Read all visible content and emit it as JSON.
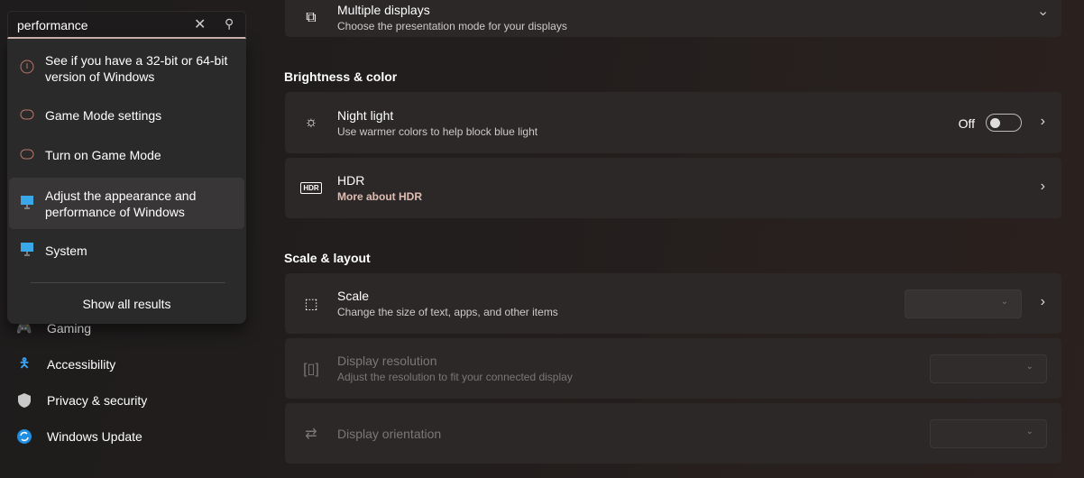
{
  "search": {
    "value": "performance",
    "clear_icon": "close-icon",
    "search_icon": "search-icon"
  },
  "search_results": [
    {
      "label": "See if you have a 32-bit or 64-bit version of Windows",
      "icon": "info-icon"
    },
    {
      "label": "Game Mode settings",
      "icon": "gamepad-icon"
    },
    {
      "label": "Turn on Game Mode",
      "icon": "gamepad-icon"
    },
    {
      "label": "Adjust the appearance and performance of Windows",
      "icon": "monitor-icon",
      "selected": true
    },
    {
      "label": "System",
      "icon": "monitor-icon"
    }
  ],
  "show_all": "Show all results",
  "sidebar": {
    "items": [
      {
        "label": "Gaming",
        "icon": "gamepad-icon"
      },
      {
        "label": "Accessibility",
        "icon": "accessibility-icon"
      },
      {
        "label": "Privacy & security",
        "icon": "shield-icon"
      },
      {
        "label": "Windows Update",
        "icon": "update-icon"
      }
    ]
  },
  "main": {
    "multiple_displays": {
      "title": "Multiple displays",
      "subtitle": "Choose the presentation mode for your displays"
    },
    "brightness_heading": "Brightness & color",
    "night_light": {
      "title": "Night light",
      "subtitle": "Use warmer colors to help block blue light",
      "state": "Off",
      "on": false
    },
    "hdr": {
      "title": "HDR",
      "link": "More about HDR"
    },
    "scale_heading": "Scale & layout",
    "scale": {
      "title": "Scale",
      "subtitle": "Change the size of text, apps, and other items"
    },
    "resolution": {
      "title": "Display resolution",
      "subtitle": "Adjust the resolution to fit your connected display",
      "disabled": true
    },
    "orientation": {
      "title": "Display orientation",
      "disabled": true
    }
  },
  "colors": {
    "accent_link": "#e0bdb3",
    "search_underline": "#d6b9b2",
    "card": "#2c2828"
  }
}
